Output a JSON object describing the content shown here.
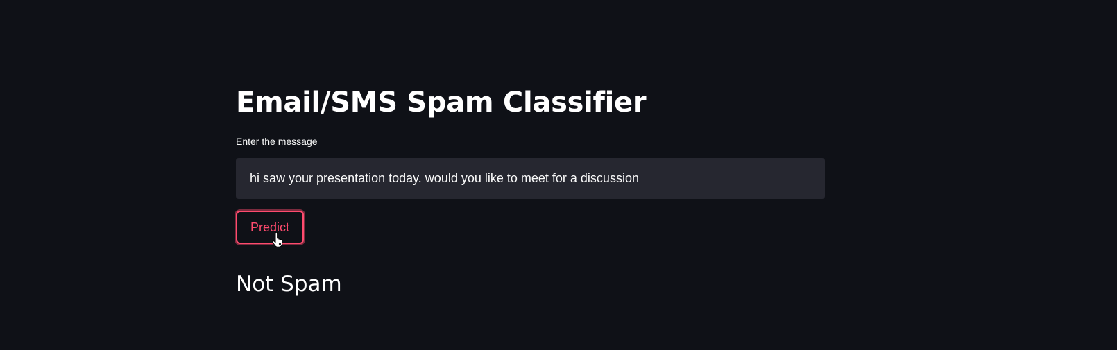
{
  "app": {
    "title": "Email/SMS Spam Classifier"
  },
  "form": {
    "label": "Enter the message",
    "input_value": "hi saw your presentation today. would you like to meet for a discussion",
    "predict_label": "Predict"
  },
  "result": {
    "text": "Not Spam"
  },
  "colors": {
    "background": "#0f1117",
    "input_bg": "#262730",
    "accent": "#ff4b6e"
  },
  "icons": {
    "cursor": "hand-pointer-icon"
  }
}
